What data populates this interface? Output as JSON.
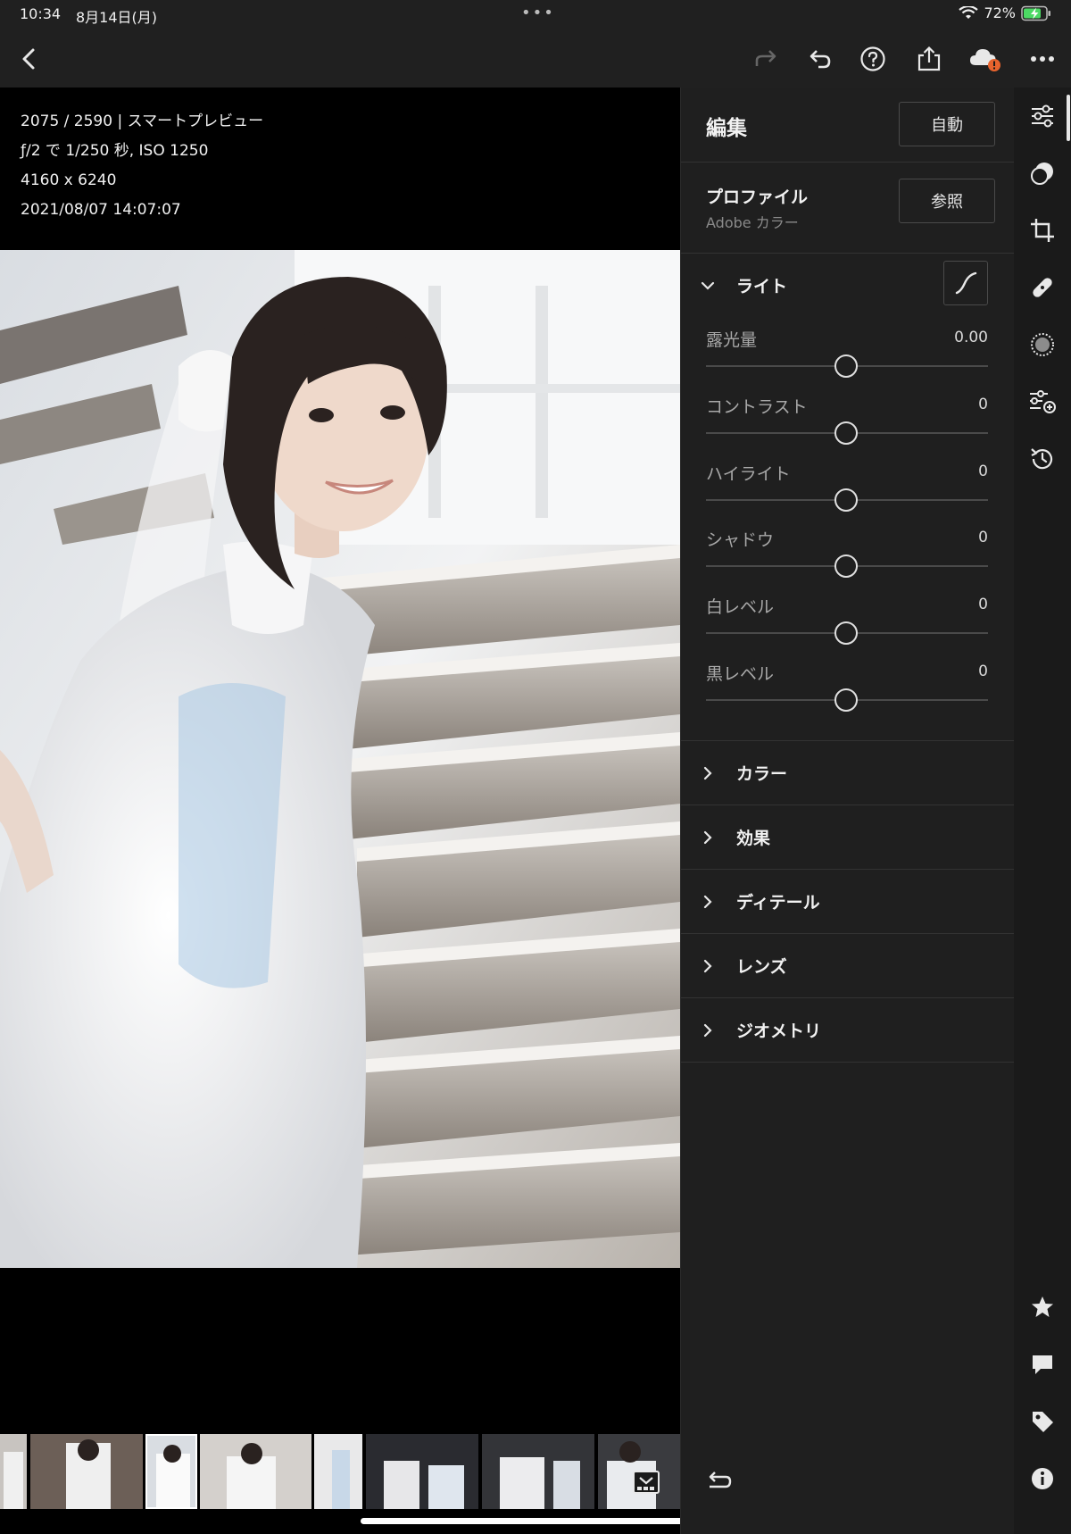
{
  "status": {
    "time": "10:34",
    "date": "8月14日(月)",
    "battery": "72%"
  },
  "photo_info": {
    "counter": "2075 / 2590 | スマートプレビュー",
    "exposure": "ƒ/2 で 1/250 秒, ISO 1250",
    "dimensions": "4160 x 6240",
    "datetime": "2021/08/07 14:07:07"
  },
  "edit_panel": {
    "title": "編集",
    "auto_label": "自動",
    "profile": {
      "label": "プロファイル",
      "value": "Adobe カラー",
      "browse_label": "参照"
    },
    "light": {
      "label": "ライト",
      "sliders": [
        {
          "label": "露光量",
          "value": "0.00"
        },
        {
          "label": "コントラスト",
          "value": "0"
        },
        {
          "label": "ハイライト",
          "value": "0"
        },
        {
          "label": "シャドウ",
          "value": "0"
        },
        {
          "label": "白レベル",
          "value": "0"
        },
        {
          "label": "黒レベル",
          "value": "0"
        }
      ]
    },
    "sections": [
      {
        "label": "カラー"
      },
      {
        "label": "効果"
      },
      {
        "label": "ディテール"
      },
      {
        "label": "レンズ"
      },
      {
        "label": "ジオメトリ"
      }
    ]
  },
  "toolbar_icons": [
    "back-icon",
    "redo-icon",
    "undo-icon",
    "help-icon",
    "share-icon",
    "cloud-alert-icon",
    "more-icon"
  ],
  "rail_icons": [
    "edit-sliders-icon",
    "masking-icon",
    "crop-icon",
    "healing-icon",
    "selective-icon",
    "presets-icon",
    "history-icon",
    "star-icon",
    "comment-icon",
    "tag-icon",
    "info-icon"
  ],
  "colors": {
    "panel_bg": "#1f1f1f",
    "rail_bg": "#1a1a1a",
    "alert": "#e8632d",
    "battery_green": "#4cd964"
  }
}
